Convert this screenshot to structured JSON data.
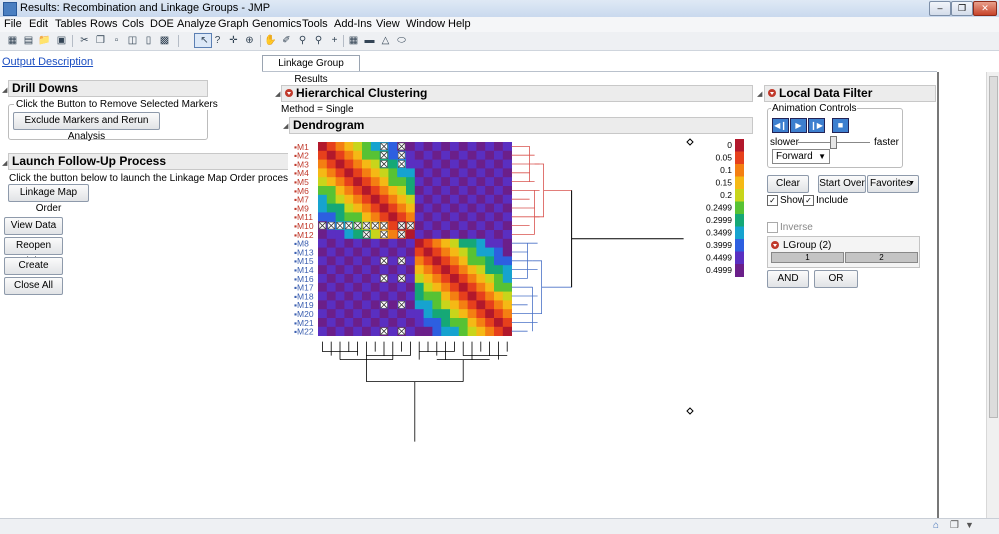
{
  "window": {
    "title": "Results: Recombination and Linkage Groups - JMP"
  },
  "menu": [
    "File",
    "Edit",
    "Tables",
    "Rows",
    "Cols",
    "DOE",
    "Analyze",
    "Graph",
    "Genomics",
    "Tools",
    "Add-Ins",
    "View",
    "Window",
    "Help"
  ],
  "left": {
    "output_link": "Output Description",
    "drill_title": "Drill Downs",
    "drill_group_label": "Click the Button to Remove Selected Markers",
    "exclude_btn": "Exclude Markers and Rerun Analysis",
    "launch_title": "Launch Follow-Up Process",
    "launch_text": "Click the button below to launch the Linkage Map Order process.",
    "linkage_btn": "Linkage Map Order",
    "view_data": "View Data",
    "reopen_dialog": "Reopen Dialog",
    "create_report": "Create Report",
    "close_all": "Close All"
  },
  "tab": {
    "label": "Linkage Group Results"
  },
  "hc": {
    "title": "Hierarchical Clustering",
    "method": "Method = Single",
    "dendro_title": "Dendrogram"
  },
  "markers": [
    "M1",
    "M2",
    "M3",
    "M4",
    "M5",
    "M6",
    "M7",
    "M9",
    "M11",
    "M10",
    "M12",
    "M8",
    "M13",
    "M15",
    "M14",
    "M16",
    "M17",
    "M18",
    "M19",
    "M20",
    "M21",
    "M22"
  ],
  "legend": [
    "0",
    "0.05",
    "0.1",
    "0.15",
    "0.2",
    "0.2499",
    "0.2999",
    "0.3499",
    "0.3999",
    "0.4499",
    "0.4999"
  ],
  "colors": [
    "#b2182b",
    "#e6401c",
    "#f47f12",
    "#f5b915",
    "#c8d51b",
    "#57c234",
    "#15a876",
    "#16a3cf",
    "#2d5fe0",
    "#5a2fc1",
    "#6b1f8a"
  ],
  "filter": {
    "title": "Local Data Filter",
    "anim_label": "Animation Controls",
    "slower": "slower",
    "faster": "faster",
    "direction": "Forward",
    "clear": "Clear",
    "start_over": "Start Over",
    "favorites": "Favorites",
    "show": "Show",
    "include": "Include",
    "inverse": "Inverse",
    "lgroup": "LGroup (2)",
    "lg1": "1",
    "lg2": "2",
    "and": "AND",
    "or": "OR"
  }
}
